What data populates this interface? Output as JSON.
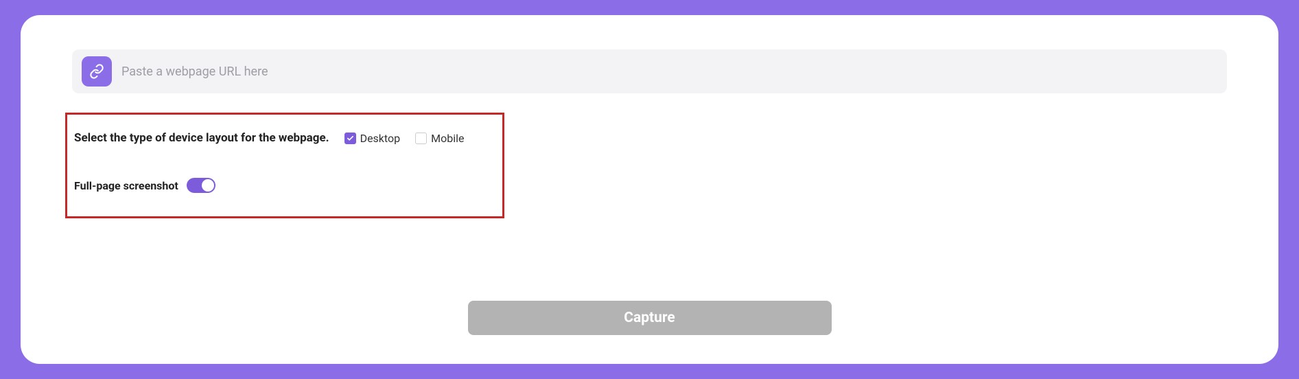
{
  "url_input": {
    "placeholder": "Paste a webpage URL here",
    "value": ""
  },
  "device_section": {
    "label": "Select the type of device layout for the webpage.",
    "options": {
      "desktop": {
        "label": "Desktop",
        "checked": true
      },
      "mobile": {
        "label": "Mobile",
        "checked": false
      }
    }
  },
  "fullpage": {
    "label": "Full-page screenshot",
    "enabled": true
  },
  "capture_button": {
    "label": "Capture"
  },
  "colors": {
    "accent": "#7c5cdb",
    "bg": "#8b6de8",
    "highlight_border": "#c62828"
  }
}
